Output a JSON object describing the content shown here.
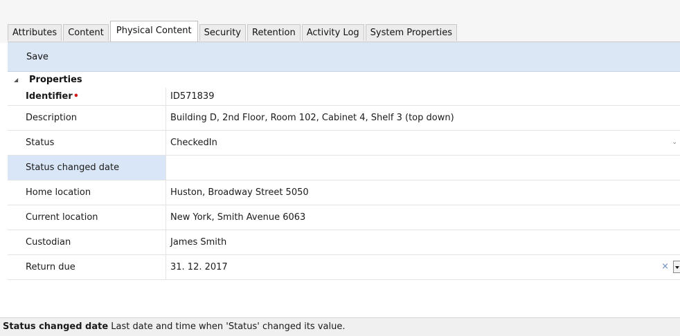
{
  "tabs": [
    {
      "label": "Attributes"
    },
    {
      "label": "Content"
    },
    {
      "label": "Physical Content",
      "active": true
    },
    {
      "label": "Security"
    },
    {
      "label": "Retention"
    },
    {
      "label": "Activity Log"
    },
    {
      "label": "System Properties"
    }
  ],
  "toolbar": {
    "save_label": "Save"
  },
  "properties": {
    "group_label": "Properties",
    "rows": [
      {
        "name": "Identifier",
        "value": "ID571839",
        "required": true
      },
      {
        "name": "Description",
        "value": "Building D, 2nd Floor, Room 102, Cabinet 4, Shelf 3 (top down)"
      },
      {
        "name": "Status",
        "value": "CheckedIn"
      },
      {
        "name": "Status changed date",
        "value": "",
        "selected": true
      },
      {
        "name": "Home location",
        "value": "Huston, Broadway Street 5050"
      },
      {
        "name": "Current location",
        "value": "New York, Smith Avenue 6063"
      },
      {
        "name": "Custodian",
        "value": "James Smith"
      },
      {
        "name": "Return due",
        "value": "31. 12. 2017"
      }
    ]
  },
  "icons": {
    "group_collapse": "collapse-triangle-icon",
    "status_dropdown": "chevron-down-icon",
    "clear": "clear-x-icon",
    "date_picker": "dropdown-arrow-icon"
  },
  "statusbar": {
    "title": "Status changed date",
    "description": "Last date and time when 'Status' changed its value."
  },
  "colors": {
    "toolbar_bg": "#dce7f5",
    "selected_row_bg": "#d9e6f7",
    "required_marker": "#d21b1b",
    "clear_icon": "#6a8cbf"
  }
}
